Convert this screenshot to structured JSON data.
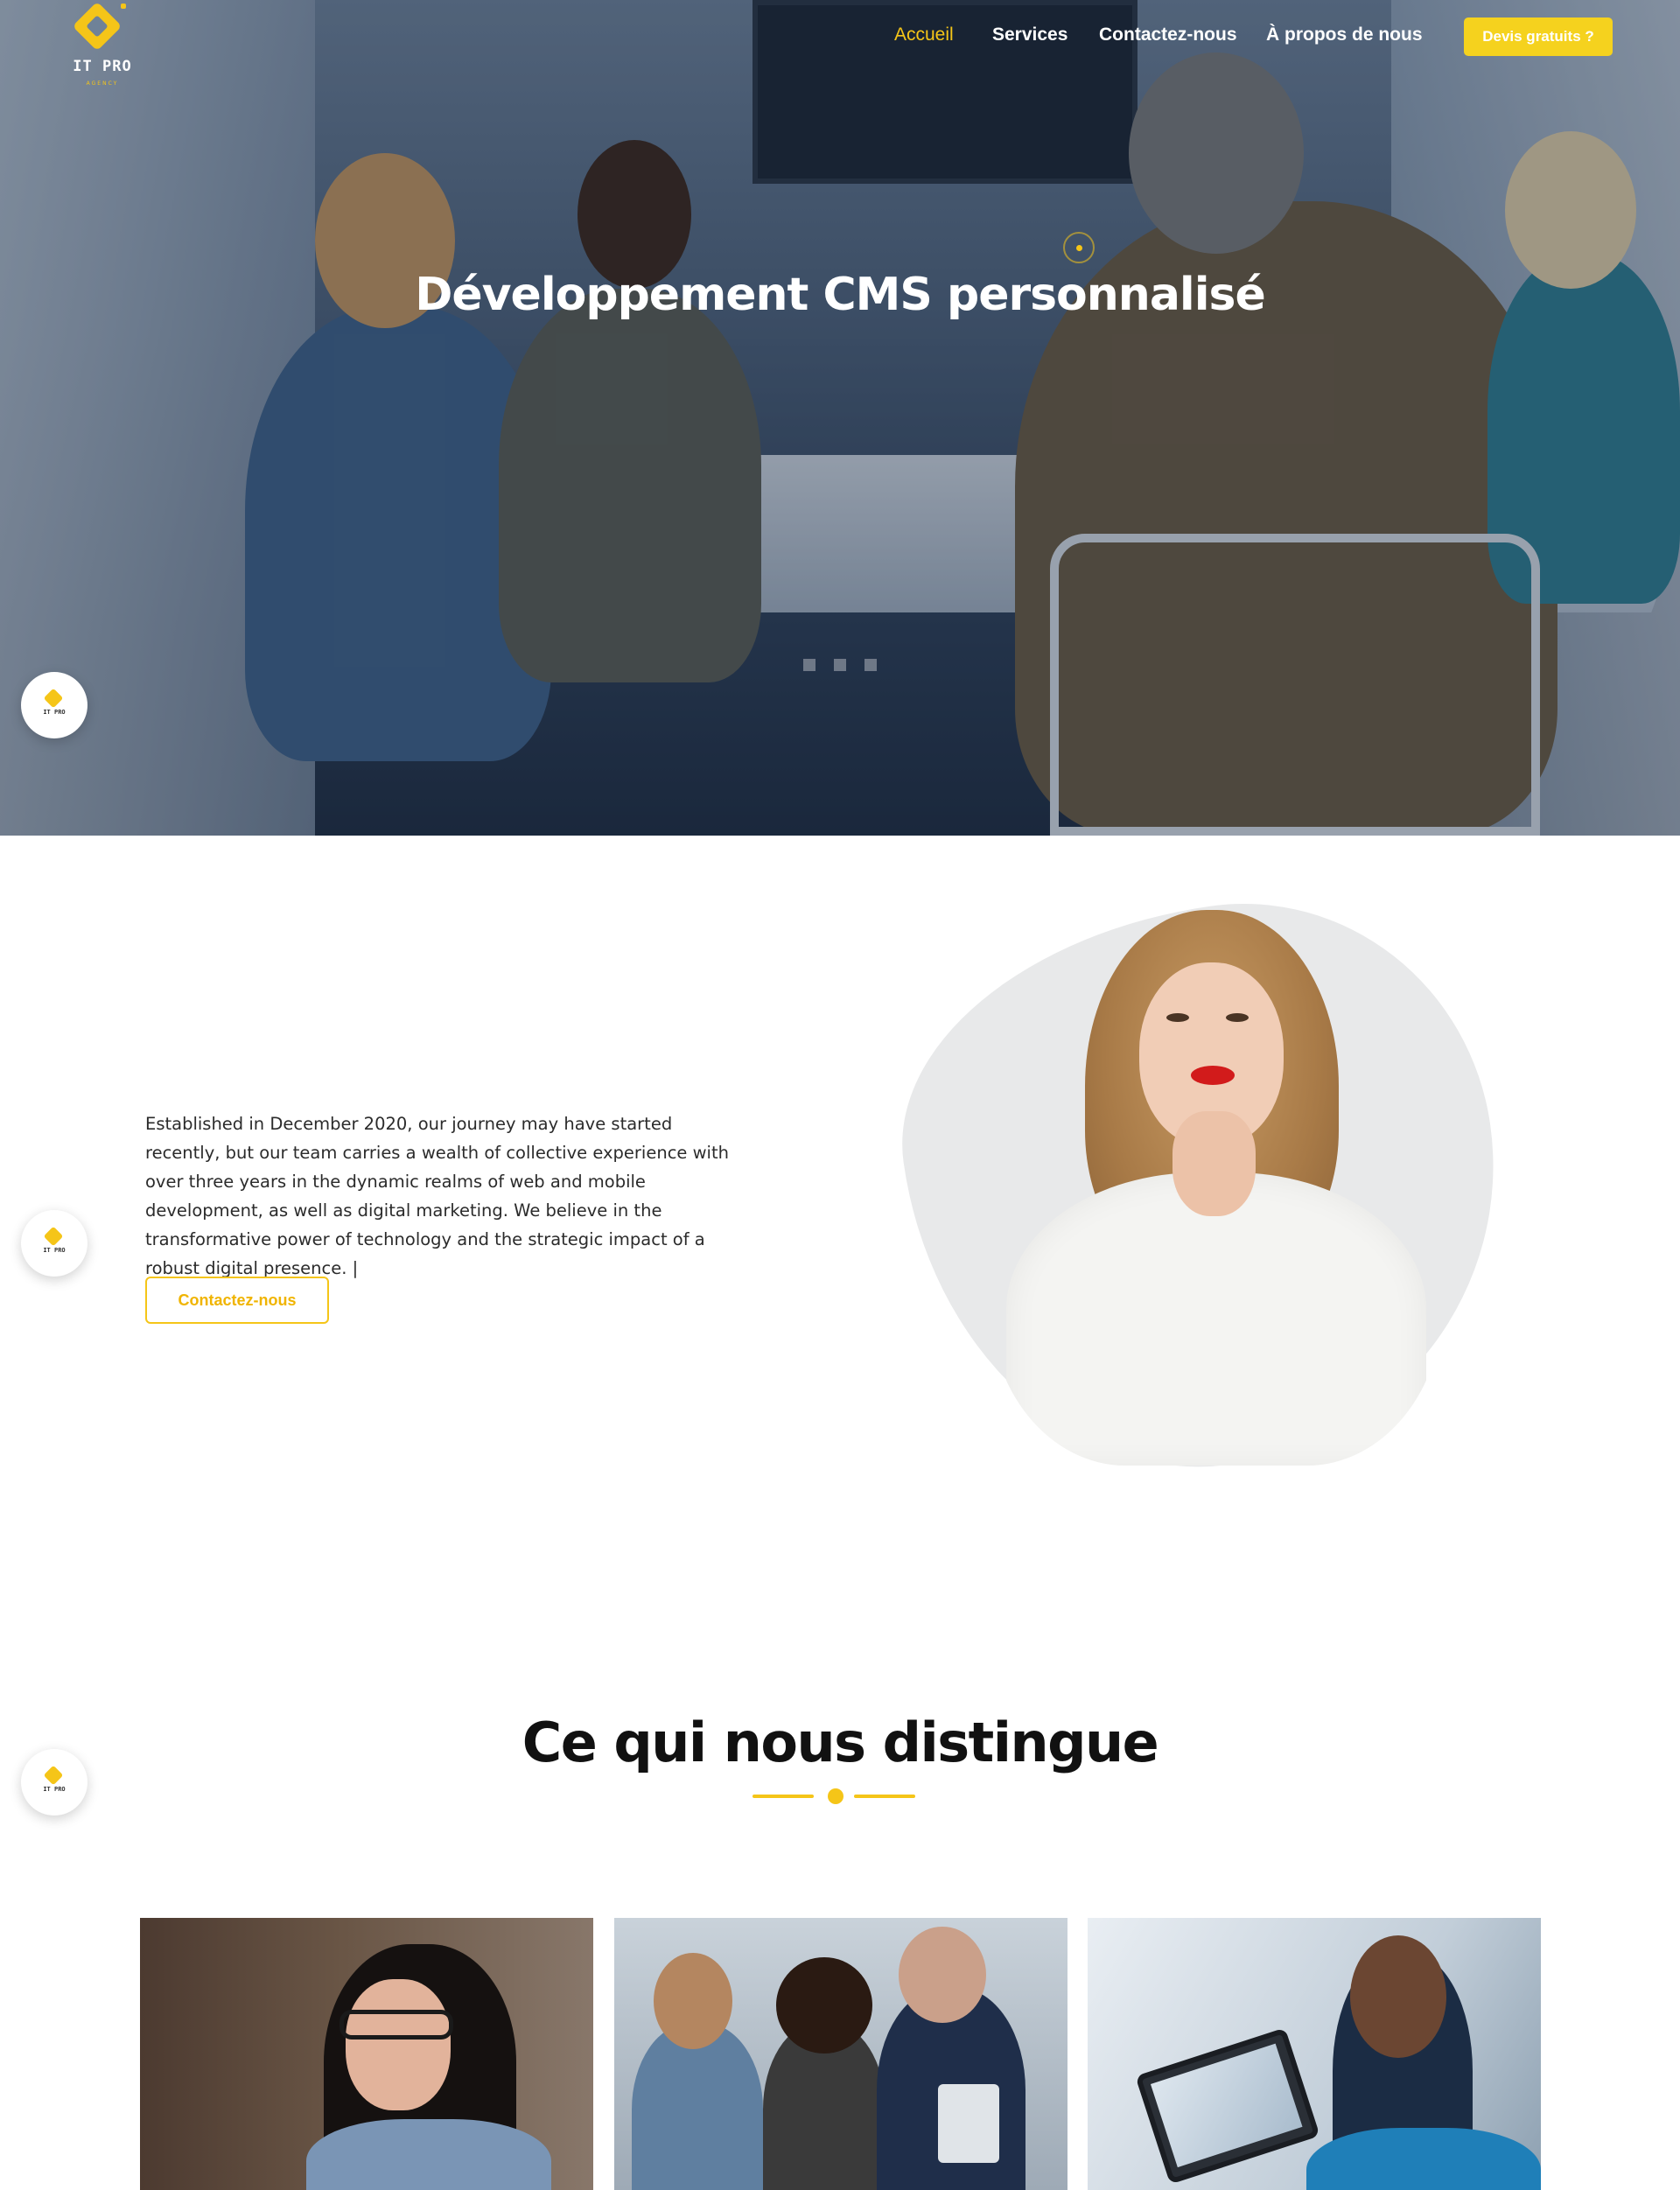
{
  "brand": {
    "name": "IT PRO",
    "tagline": "AGENCY",
    "accent_color": "#f5c518",
    "badge_label": "IT PRO"
  },
  "nav": {
    "items": [
      {
        "label": "Accueil",
        "active": true
      },
      {
        "label": "Services",
        "active": false
      },
      {
        "label": "Contactez-nous",
        "active": false
      },
      {
        "label": "À propos de nous",
        "active": false
      }
    ],
    "cta_label": "Devis gratuits ?"
  },
  "hero": {
    "title": "Développement CMS personnalisé",
    "slide_count": 3
  },
  "about": {
    "text": "Established in December 2020, our journey may have started recently, but our team carries a wealth of collective experience with over three years in the dynamic realms of web and mobile development, as well as digital marketing. We believe in the transformative power of technology and the strategic impact of a robust digital presence. |",
    "button_label": "Contactez-nous"
  },
  "distinction": {
    "title": "Ce qui nous distingue"
  }
}
